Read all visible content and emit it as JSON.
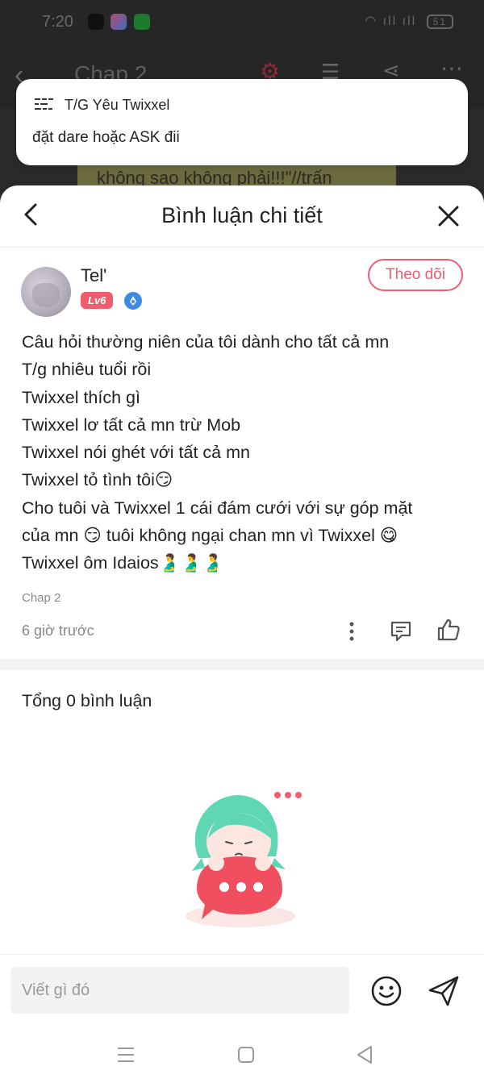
{
  "status_bar": {
    "time": "7:20",
    "signal_text": "ıll ıll",
    "battery": "51"
  },
  "reader": {
    "title": "Chap 2",
    "content_snippet": "không sao không phải!!!\"//trấn"
  },
  "notification": {
    "sender": "T/G Yêu Twixxel",
    "message": "đặt dare hoặc ASK đii"
  },
  "sheet": {
    "title": "Bình luận chi tiết"
  },
  "comment": {
    "username": "Tel'",
    "level": "Lv6",
    "follow_label": "Theo dõi",
    "lines": [
      "Câu hỏi thường niên của tôi dành cho tất cả mn",
      "T/g nhiêu tuổi rồi",
      "Twixxel thích gì",
      "Twixxel lơ tất cả mn trừ Mob",
      "Twixxel nói ghét với tất cả mn",
      "Twixxel tỏ tình tôi😏",
      "Cho tuôi và Twixxel 1 cái đám cưới với sự góp mặt",
      "của mn 😏 tuôi không ngại chan mn vì Twixxel 😋",
      "Twixxel ôm Idaios🫃🫃🫃"
    ],
    "chapter": "Chap 2",
    "time_ago": "6 giờ trước"
  },
  "replies": {
    "total_label": "Tổng 0 bình luận"
  },
  "composer": {
    "placeholder": "Viết gì đó"
  },
  "colors": {
    "accent": "#ef5d6f",
    "badge_blue": "#3e8be3",
    "mascot_hair": "#5fd6b4"
  }
}
